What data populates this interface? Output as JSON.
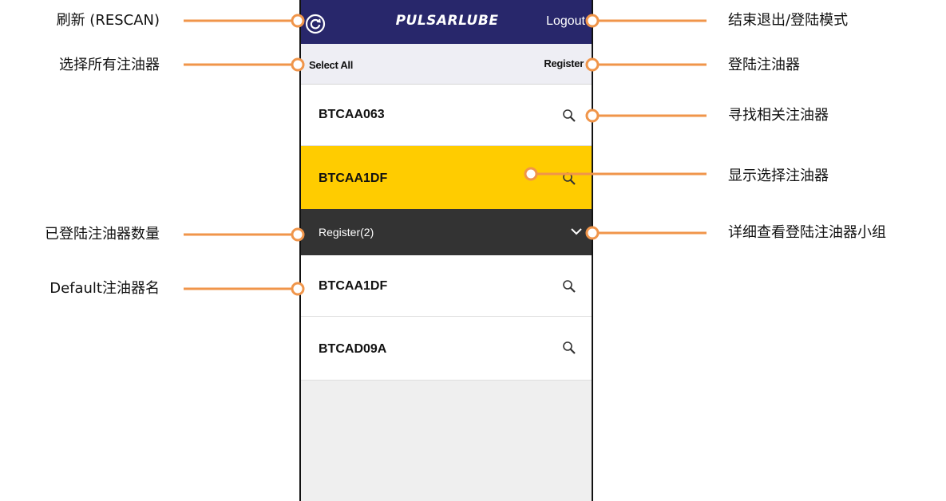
{
  "app": {
    "brand": "PULSARLUBE",
    "logout_label": "Logout",
    "select_all_label": "Select All",
    "register_label": "Register"
  },
  "devices": [
    {
      "name": "BTCAA063",
      "selected": false
    },
    {
      "name": "BTCAA1DF",
      "selected": true
    }
  ],
  "register_group": {
    "header": "Register(2)",
    "items": [
      {
        "name": "BTCAA1DF"
      },
      {
        "name": "BTCAD09A"
      }
    ]
  },
  "annotations": {
    "left": [
      "刷新 (RESCAN)",
      "选择所有注油器",
      "已登陆注油器数量",
      "Default注油器名"
    ],
    "right": [
      "结束退出/登陆模式",
      "登陆注油器",
      "寻找相关注油器",
      "显示选择注油器",
      "详细查看登陆注油器小组"
    ]
  },
  "colors": {
    "header_bg": "#28276b",
    "selected_bg": "#ffcc00",
    "group_bg": "#333333",
    "callout": "#f0954a"
  }
}
